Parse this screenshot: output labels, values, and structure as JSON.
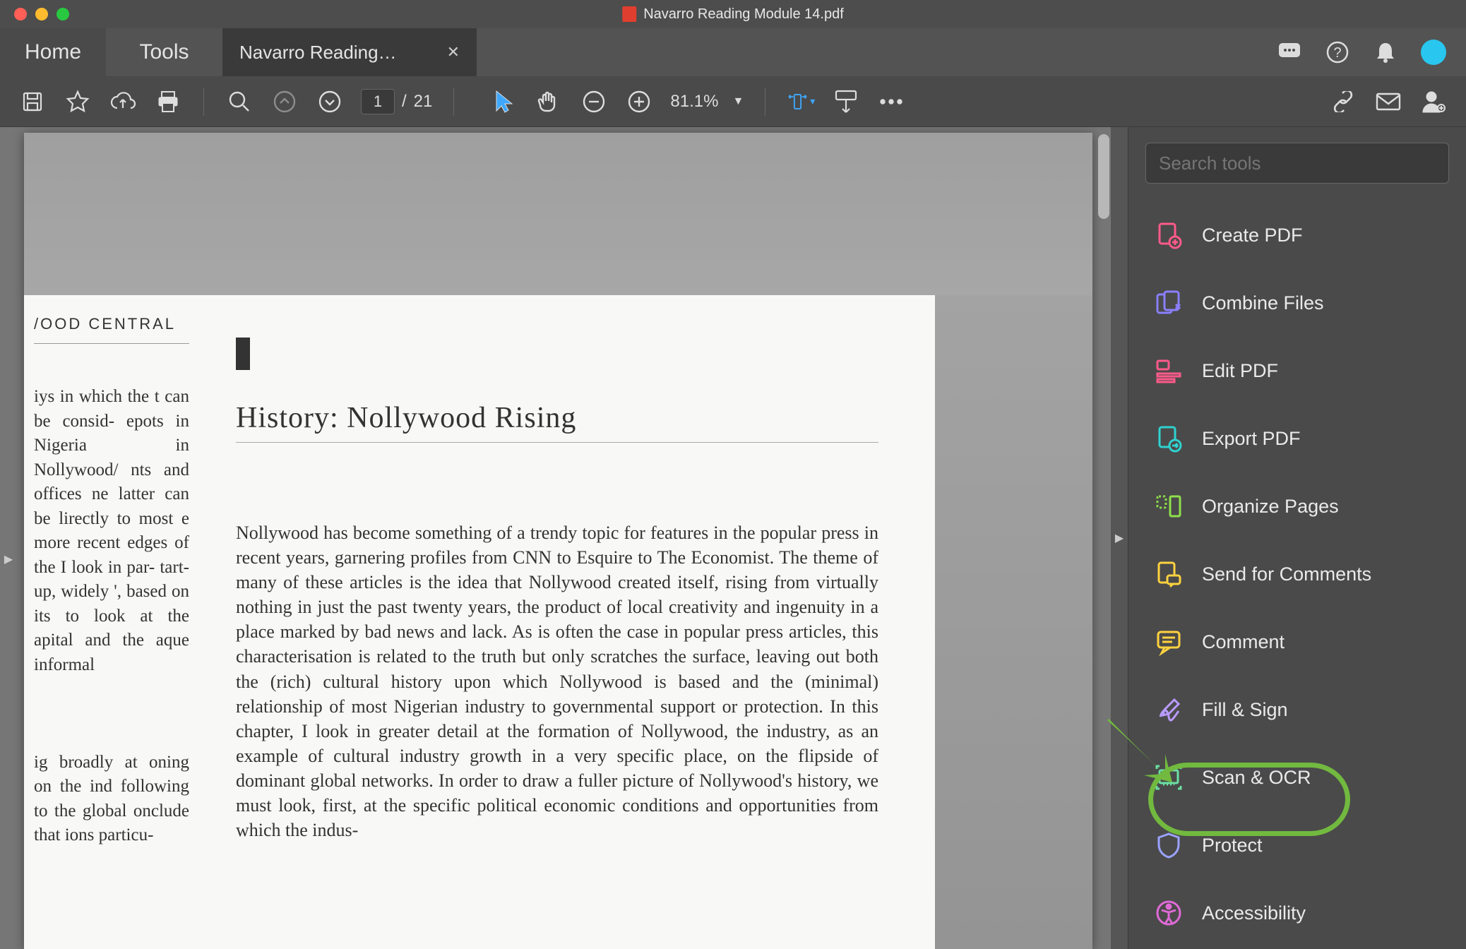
{
  "window": {
    "title": "Navarro Reading Module 14.pdf"
  },
  "tabs": {
    "home": "Home",
    "tools": "Tools",
    "doc": "Navarro Reading…"
  },
  "toolbar": {
    "current_page": "1",
    "total_pages": "21",
    "zoom": "81.1%"
  },
  "search": {
    "placeholder": "Search tools"
  },
  "tools_list": [
    {
      "label": "Create PDF",
      "icon": "create-pdf-icon",
      "color": "#ff5a8a"
    },
    {
      "label": "Combine Files",
      "icon": "combine-files-icon",
      "color": "#8a7fff"
    },
    {
      "label": "Edit PDF",
      "icon": "edit-pdf-icon",
      "color": "#ff5a8a"
    },
    {
      "label": "Export PDF",
      "icon": "export-pdf-icon",
      "color": "#2fd2d0"
    },
    {
      "label": "Organize Pages",
      "icon": "organize-pages-icon",
      "color": "#8ee04a"
    },
    {
      "label": "Send for Comments",
      "icon": "send-comments-icon",
      "color": "#ffd23f"
    },
    {
      "label": "Comment",
      "icon": "comment-tool-icon",
      "color": "#ffd23f"
    },
    {
      "label": "Fill & Sign",
      "icon": "fill-sign-icon",
      "color": "#b99bff"
    },
    {
      "label": "Scan & OCR",
      "icon": "scan-ocr-icon",
      "color": "#6be0a3"
    },
    {
      "label": "Protect",
      "icon": "protect-icon",
      "color": "#9aa3ff"
    },
    {
      "label": "Accessibility",
      "icon": "accessibility-icon",
      "color": "#e06ad8"
    }
  ],
  "document": {
    "running_head": "/OOD CENTRAL",
    "left_fragment": "iys in which the t can be consid- epots in Nigeria in Nollywood/ nts and offices ne latter can be lirectly to most e more recent edges of the I look in par- tart-up, widely ', based on its to look at the apital and the aque informal\n\n\n\nig broadly at oning on the ind following to the global onclude that ions particu-",
    "chapter_number": "I",
    "chapter_title": "History: Nollywood Rising",
    "body": "Nollywood has become something of a trendy topic for features in the popular press in recent years, garnering profiles from CNN to Esquire to The Economist. The theme of many of these articles is the idea that Nollywood created itself, rising from virtually nothing in just the past twenty years, the product of local creativity and ingenuity in a place marked by bad news and lack. As is often the case in popular press articles, this characterisation is related to the truth but only scratches the surface, leaving out both the (rich) cultural history upon which Nollywood is based and the (minimal) relationship of most Nigerian industry to governmental support or protection. In this chapter, I look in greater detail at the formation of Nollywood, the industry, as an example of cultural industry growth in a very specific place, on the flipside of dominant global networks. In order to draw a fuller picture of Nollywood's history, we must look, first, at the specific political economic conditions and opportunities from which the indus-"
  }
}
